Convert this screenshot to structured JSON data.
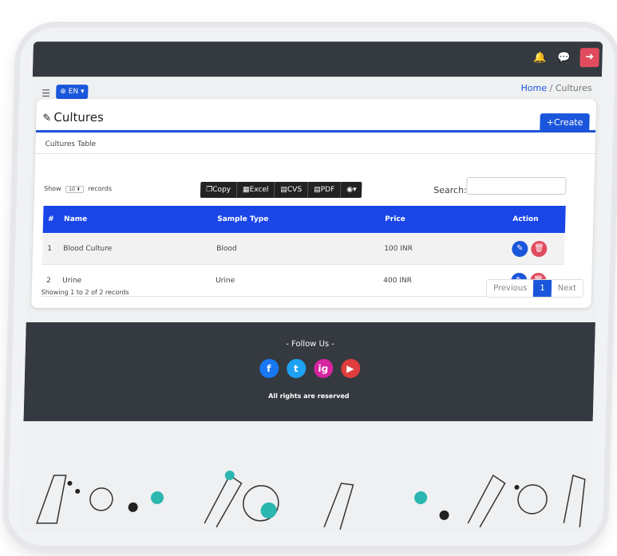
{
  "topbar": {
    "icons": {
      "notifications": "bell-icon",
      "messages": "chat-icon",
      "logout": "logout-icon"
    }
  },
  "header": {
    "menu_icon": "hamburger-icon",
    "language": "EN"
  },
  "breadcrumb": {
    "home": "Home",
    "separator": "/",
    "current": "Cultures"
  },
  "page": {
    "title": "Cultures",
    "create_label": "Create"
  },
  "table_section": {
    "label": "Cultures Table",
    "show_prefix": "Show",
    "page_size": "10",
    "show_suffix": "records",
    "export_buttons": [
      "Copy",
      "Excel",
      "CVS",
      "PDF"
    ],
    "search_label": "Search:",
    "search_value": ""
  },
  "table": {
    "columns": [
      "#",
      "Name",
      "Sample Type",
      "Price",
      "Action"
    ],
    "rows": [
      {
        "index": "1",
        "name": "Blood Culture",
        "sample_type": "Blood",
        "price": "100 INR"
      },
      {
        "index": "2",
        "name": "Urine",
        "sample_type": "Urine",
        "price": "400 INR"
      }
    ]
  },
  "pagination": {
    "summary": "Showing 1 to 2 of 2 records",
    "previous": "Previous",
    "current_page": "1",
    "next": "Next"
  },
  "footer": {
    "follow": "- Follow Us -",
    "social": [
      {
        "name": "facebook",
        "letter": "f",
        "color": "#1877f2"
      },
      {
        "name": "twitter",
        "letter": "t",
        "color": "#1da1f2"
      },
      {
        "name": "instagram",
        "letter": "ig",
        "color": "#d6249f"
      },
      {
        "name": "youtube",
        "letter": "▶",
        "color": "#e03e3e"
      }
    ],
    "rights": "All rights are reserved"
  },
  "colors": {
    "accent": "#1a56db",
    "table_header": "#1a46e8",
    "danger": "#e04b5e",
    "dark": "#343a40",
    "teal": "#2bb6b0"
  }
}
